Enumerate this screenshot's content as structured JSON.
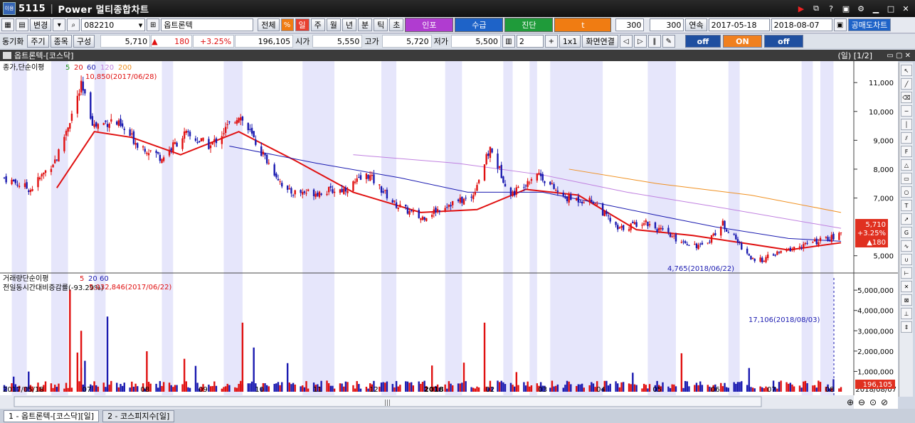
{
  "title_bar": {
    "code": "5115",
    "title": "Power 멀티종합차트",
    "icon": "app-icon"
  },
  "toolbar1": {
    "change_label": "변경",
    "code_value": "082210",
    "name_value": "옵트론텍",
    "all_label": "전체",
    "period_tabs": [
      "일",
      "주",
      "월",
      "년",
      "분",
      "틱",
      "초"
    ],
    "colored_buttons": [
      {
        "label": "인포",
        "color": "#b03cd0"
      },
      {
        "label": "수급",
        "color": "#1e63c8"
      },
      {
        "label": "진단",
        "color": "#1f9b3a"
      },
      {
        "label": "t",
        "color": "#f07c12"
      }
    ],
    "count1": "300",
    "count2": "300",
    "continue_label": "연속",
    "date_from": "2017-05-18",
    "date_to": "2018-08-07",
    "short_sell_label": "공매도차트"
  },
  "toolbar2": {
    "sync_label": "동기화",
    "cycle_label": "주기",
    "stock_label": "종목",
    "config_label": "구성",
    "price": "5,710",
    "change": "180",
    "change_pct": "+3.25%",
    "volume": "196,105",
    "open_label": "시가",
    "open": "5,550",
    "high_label": "고가",
    "high": "5,720",
    "low_label": "저가",
    "low": "5,500",
    "split_count": "2",
    "one_by_one": "1x1",
    "screen_link": "화면연결",
    "toggles": [
      {
        "label": "off",
        "color": "#1f4fa0"
      },
      {
        "label": "ON",
        "color": "#f08020"
      },
      {
        "label": "off",
        "color": "#1f4fa0"
      }
    ]
  },
  "chart_header": {
    "title": "옵트론텍-[코스닥]",
    "right": "(일) [1/2]"
  },
  "chart_data": {
    "type": "candlestick",
    "x_tick_labels": [
      "2017/05/18",
      "07",
      "08",
      "09",
      "10",
      "11",
      "12",
      "2018",
      "02",
      "03",
      "04",
      "05",
      "06",
      "07",
      "08",
      "2018/08/07"
    ],
    "price_axis": {
      "ylim": [
        4500,
        11300
      ],
      "ticks": [
        "11,000",
        "10,000",
        "9,000",
        "8,000",
        "7,000",
        "5,000"
      ]
    },
    "price_legend": {
      "name": "종가,단순이평",
      "periods": [
        "5",
        "20",
        "60",
        "120",
        "200"
      ],
      "colors": [
        "#1f8f1f",
        "#e01010",
        "#1a1ab0",
        "#c080e0",
        "#f09020"
      ]
    },
    "max_annotation": "10,850(2017/06/28)",
    "min_annotation": "4,765(2018/06/22)",
    "last_price_box": {
      "price": "5,710",
      "pct": "+3.25%",
      "change": "▲180"
    },
    "volume_legend": {
      "name": "거래량단순이평",
      "periods": [
        "5",
        "20",
        "60"
      ]
    },
    "volume_note": "전일동시간대비증감률(-93.29%)",
    "volume_max_annotation": "5,032,846(2017/06/22)",
    "volume_min_annotation": "17,106(2018/08/03)",
    "volume_axis": {
      "ylim": [
        0,
        5600000
      ],
      "ticks": [
        "5,000,000",
        "4,000,000",
        "3,000,000",
        "2,000,000",
        "1,000,000"
      ]
    },
    "last_volume": "196,105",
    "shaded_date_ranges": [
      [
        "2017-05-22",
        "2017-05-30"
      ],
      [
        "2017-06-12",
        "2017-06-21"
      ],
      [
        "2017-07-05",
        "2017-07-11"
      ],
      [
        "2017-08-10",
        "2017-08-16"
      ],
      [
        "2017-09-12",
        "2017-09-22"
      ],
      [
        "2017-10-24",
        "2017-11-10"
      ],
      [
        "2017-12-05",
        "2017-12-13"
      ],
      [
        "2018-01-08",
        "2018-01-17"
      ],
      [
        "2018-02-08",
        "2018-02-13"
      ],
      [
        "2018-02-22",
        "2018-02-26"
      ],
      [
        "2018-03-05",
        "2018-04-02"
      ],
      [
        "2018-04-26",
        "2018-05-11"
      ],
      [
        "2018-06-08",
        "2018-06-14"
      ],
      [
        "2018-07-17",
        "2018-07-23"
      ],
      [
        "2018-07-27",
        "2018-08-03"
      ]
    ],
    "ohlc_anchors": [
      [
        "2017-05-18",
        7700
      ],
      [
        "2017-06-01",
        7300
      ],
      [
        "2017-06-15",
        8400
      ],
      [
        "2017-06-28",
        10850
      ],
      [
        "2017-07-05",
        9500
      ],
      [
        "2017-07-15",
        9700
      ],
      [
        "2017-07-28",
        8900
      ],
      [
        "2017-08-10",
        8400
      ],
      [
        "2017-08-22",
        9200
      ],
      [
        "2017-09-05",
        8800
      ],
      [
        "2017-09-20",
        9900
      ],
      [
        "2017-10-02",
        8600
      ],
      [
        "2017-10-16",
        7200
      ],
      [
        "2017-11-01",
        7200
      ],
      [
        "2017-11-15",
        7300
      ],
      [
        "2017-11-28",
        7800
      ],
      [
        "2017-12-12",
        6800
      ],
      [
        "2017-12-26",
        6300
      ],
      [
        "2018-01-10",
        6800
      ],
      [
        "2018-01-22",
        7000
      ],
      [
        "2018-02-01",
        8700
      ],
      [
        "2018-02-12",
        7100
      ],
      [
        "2018-02-26",
        7900
      ],
      [
        "2018-03-12",
        7000
      ],
      [
        "2018-03-28",
        6900
      ],
      [
        "2018-04-10",
        5900
      ],
      [
        "2018-04-24",
        6200
      ],
      [
        "2018-05-10",
        5600
      ],
      [
        "2018-05-25",
        5300
      ],
      [
        "2018-06-05",
        6100
      ],
      [
        "2018-06-22",
        4765
      ],
      [
        "2018-07-05",
        5100
      ],
      [
        "2018-07-20",
        5400
      ],
      [
        "2018-08-07",
        5710
      ]
    ],
    "ma_lines": [
      {
        "period": "20",
        "color": "#e01010",
        "points": [
          [
            "2017-06-15",
            7350
          ],
          [
            "2017-07-05",
            9300
          ],
          [
            "2017-07-25",
            9100
          ],
          [
            "2017-08-20",
            8500
          ],
          [
            "2017-09-20",
            9300
          ],
          [
            "2017-10-20",
            8300
          ],
          [
            "2017-11-20",
            7200
          ],
          [
            "2017-12-26",
            6500
          ],
          [
            "2018-01-25",
            6600
          ],
          [
            "2018-02-20",
            7300
          ],
          [
            "2018-03-20",
            7100
          ],
          [
            "2018-04-20",
            5900
          ],
          [
            "2018-05-20",
            5700
          ],
          [
            "2018-06-20",
            5400
          ],
          [
            "2018-07-10",
            5200
          ],
          [
            "2018-08-07",
            5450
          ]
        ]
      },
      {
        "period": "60",
        "color": "#1a1ab0",
        "points": [
          [
            "2017-09-15",
            8800
          ],
          [
            "2017-11-01",
            8200
          ],
          [
            "2017-12-15",
            7700
          ],
          [
            "2018-01-20",
            7200
          ],
          [
            "2018-03-01",
            7200
          ],
          [
            "2018-04-01",
            6800
          ],
          [
            "2018-05-01",
            6400
          ],
          [
            "2018-06-01",
            6000
          ],
          [
            "2018-07-10",
            5600
          ],
          [
            "2018-08-07",
            5500
          ]
        ]
      },
      {
        "period": "120",
        "color": "#c080e0",
        "points": [
          [
            "2017-11-20",
            8500
          ],
          [
            "2018-01-15",
            8200
          ],
          [
            "2018-03-01",
            7800
          ],
          [
            "2018-04-15",
            7200
          ],
          [
            "2018-06-01",
            6700
          ],
          [
            "2018-08-07",
            5950
          ]
        ]
      },
      {
        "period": "200",
        "color": "#f09020",
        "points": [
          [
            "2018-03-15",
            8000
          ],
          [
            "2018-05-01",
            7500
          ],
          [
            "2018-06-20",
            7100
          ],
          [
            "2018-08-07",
            6500
          ]
        ]
      }
    ]
  },
  "tabs": [
    "1 - 옵트론텍-[코스닥][일]",
    "2 - 코스피지수[일]"
  ]
}
